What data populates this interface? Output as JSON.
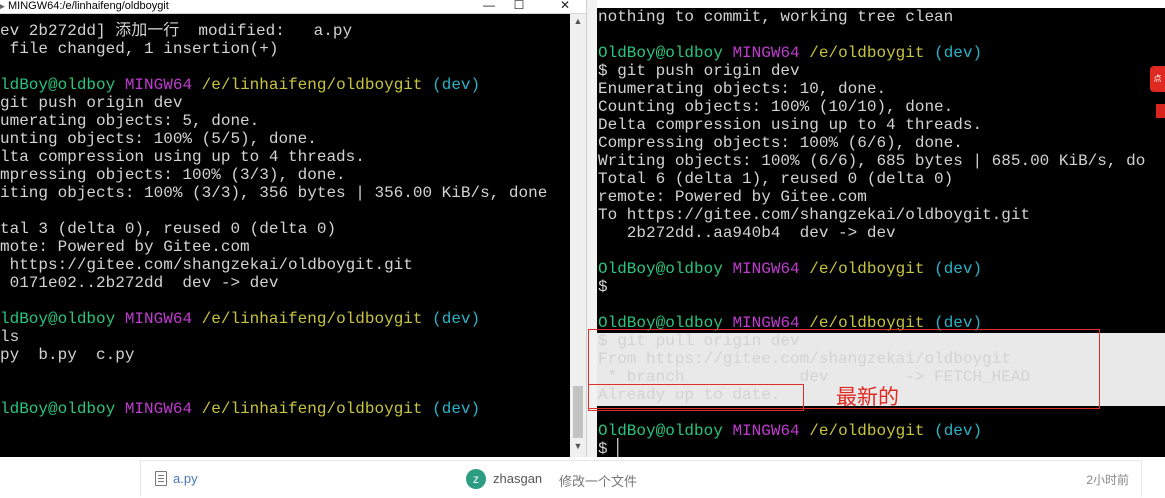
{
  "left_window": {
    "title": "MINGW64:/e/linhaifeng/oldboygit",
    "controls": {
      "minimize": "—",
      "maximize": "☐",
      "close": "✕"
    },
    "scrollbar": {
      "up": "▲",
      "down": "▼"
    },
    "lines": [
      "ev 2b272dd] 添加一行  modified:   a.py",
      " file changed, 1 insertion(+)",
      "",
      {
        "user": "ldBoy@oldboy",
        "env": "MINGW64",
        "path": "/e/linhaifeng/oldboygit",
        "branch": "(dev)"
      },
      "git push origin dev",
      "umerating objects: 5, done.",
      "unting objects: 100% (5/5), done.",
      "lta compression using up to 4 threads.",
      "mpressing objects: 100% (3/3), done.",
      "iting objects: 100% (3/3), 356 bytes | 356.00 KiB/s, done",
      "",
      "tal 3 (delta 0), reused 0 (delta 0)",
      "mote: Powered by Gitee.com",
      " https://gitee.com/shangzekai/oldboygit.git",
      " 0171e02..2b272dd  dev -> dev",
      "",
      {
        "user": "ldBoy@oldboy",
        "env": "MINGW64",
        "path": "/e/linhaifeng/oldboygit",
        "branch": "(dev)"
      },
      "ls",
      "py  b.py  c.py",
      "",
      "",
      {
        "user": "ldBoy@oldboy",
        "env": "MINGW64",
        "path": "/e/linhaifeng/oldboygit",
        "branch": "(dev)"
      }
    ]
  },
  "right_window": {
    "lines": [
      "nothing to commit, working tree clean",
      "",
      {
        "user": "OldBoy@oldboy",
        "env": "MINGW64",
        "path": "/e/oldboygit",
        "branch": "(dev)"
      },
      "$ git push origin dev",
      "Enumerating objects: 10, done.",
      "Counting objects: 100% (10/10), done.",
      "Delta compression using up to 4 threads.",
      "Compressing objects: 100% (6/6), done.",
      "Writing objects: 100% (6/6), 685 bytes | 685.00 KiB/s, do",
      "Total 6 (delta 1), reused 0 (delta 0)",
      "remote: Powered by Gitee.com",
      "To https://gitee.com/shangzekai/oldboygit.git",
      "   2b272dd..aa940b4  dev -> dev",
      "",
      {
        "user": "OldBoy@oldboy",
        "env": "MINGW64",
        "path": "/e/oldboygit",
        "branch": "(dev)"
      },
      "$",
      "",
      {
        "user": "OldBoy@oldboy",
        "env": "MINGW64",
        "path": "/e/oldboygit",
        "branch": "(dev)"
      },
      "$ git pull origin dev",
      "From https://gitee.com/shangzekai/oldboygit",
      " * branch            dev        -> FETCH_HEAD",
      "Already up to date.",
      "",
      {
        "user": "OldBoy@oldboy",
        "env": "MINGW64",
        "path": "/e/oldboygit",
        "branch": "(dev)"
      },
      "$ ▏"
    ]
  },
  "annotation": "最新的",
  "edge_badge": "点",
  "file_row": {
    "file_name": "a.py",
    "author_initial": "z",
    "author_name": "zhasgan",
    "commit_message": "修改一个文件",
    "time": "2小时前"
  },
  "colors": {
    "user_host": "#29c47d",
    "mingw": "#c03bd0",
    "path": "#c7c43e",
    "branch": "#2ab3c7",
    "highlight": "#e0302a"
  }
}
